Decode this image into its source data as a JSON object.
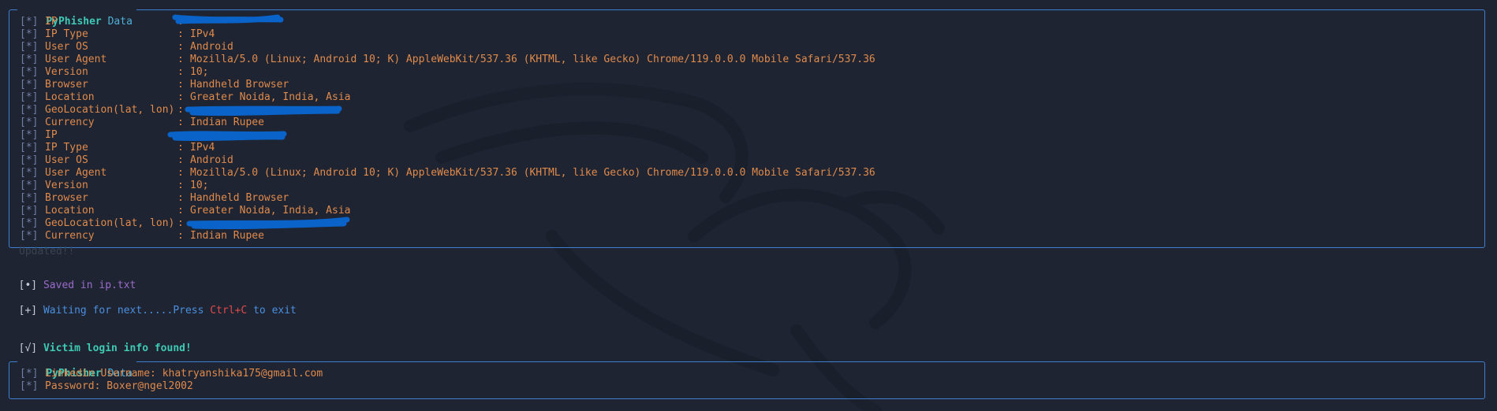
{
  "panels": [
    {
      "title_bold": "PyPhisher",
      "title_rest": " Data",
      "rows": [
        {
          "mark": "[*]",
          "key": "IP",
          "sep": ":",
          "value": ""
        },
        {
          "mark": "[*]",
          "key": "IP Type",
          "sep": ":",
          "value": "IPv4"
        },
        {
          "mark": "[*]",
          "key": "User OS",
          "sep": ":",
          "value": "Android"
        },
        {
          "mark": "[*]",
          "key": "User Agent",
          "sep": ":",
          "value": "Mozilla/5.0 (Linux; Android 10; K) AppleWebKit/537.36 (KHTML, like Gecko) Chrome/119.0.0.0 Mobile Safari/537.36"
        },
        {
          "mark": "[*]",
          "key": "Version",
          "sep": ":",
          "value": "10;"
        },
        {
          "mark": "[*]",
          "key": "Browser",
          "sep": ":",
          "value": "Handheld Browser"
        },
        {
          "mark": "[*]",
          "key": "Location",
          "sep": ":",
          "value": "Greater Noida, India, Asia"
        },
        {
          "mark": "[*]",
          "key": "GeoLocation(lat, lon)",
          "sep": ":",
          "value": ""
        },
        {
          "mark": "[*]",
          "key": "Currency",
          "sep": ":",
          "value": "Indian Rupee"
        },
        {
          "mark": "[*]",
          "key": "IP",
          "sep": ":",
          "value": ""
        },
        {
          "mark": "[*]",
          "key": "IP Type",
          "sep": ":",
          "value": "IPv4"
        },
        {
          "mark": "[*]",
          "key": "User OS",
          "sep": ":",
          "value": "Android"
        },
        {
          "mark": "[*]",
          "key": "User Agent",
          "sep": ":",
          "value": "Mozilla/5.0 (Linux; Android 10; K) AppleWebKit/537.36 (KHTML, like Gecko) Chrome/119.0.0.0 Mobile Safari/537.36"
        },
        {
          "mark": "[*]",
          "key": "Version",
          "sep": ":",
          "value": "10;"
        },
        {
          "mark": "[*]",
          "key": "Browser",
          "sep": ":",
          "value": "Handheld Browser"
        },
        {
          "mark": "[*]",
          "key": "Location",
          "sep": ":",
          "value": "Greater Noida, India, Asia"
        },
        {
          "mark": "[*]",
          "key": "GeoLocation(lat, lon)",
          "sep": ":",
          "value": ""
        },
        {
          "mark": "[*]",
          "key": "Currency",
          "sep": ":",
          "value": "Indian Rupee"
        }
      ]
    },
    {
      "title_bold": "PyPhisher",
      "title_rest": " Data",
      "lines": [
        {
          "mark": "[*]",
          "text": "Linkedin Username: khatryanshika175@gmail.com"
        },
        {
          "mark": "[*]",
          "text": "Password: Boxer@ngel2002"
        }
      ]
    }
  ],
  "messages": {
    "faded": "Updated!!",
    "saved_mark": "[•]",
    "saved_text": "Saved in ip.txt",
    "waiting_mark": "[+]",
    "waiting_text": "Waiting for next.....Press ",
    "waiting_key": "Ctrl+C",
    "waiting_tail": " to exit",
    "found_mark": "[√]",
    "found_text": "Victim login info found!"
  },
  "colors": {
    "background": "#1e2431",
    "border": "#3f7fd0",
    "value_orange": "#e08a4c",
    "cyan": "#3fcab3",
    "purple": "#9b6ccb",
    "blue": "#4b8fe0",
    "red": "#e04a4a",
    "redaction_blue": "#0a63c8"
  },
  "background_art": "kali-dragon-watermark"
}
